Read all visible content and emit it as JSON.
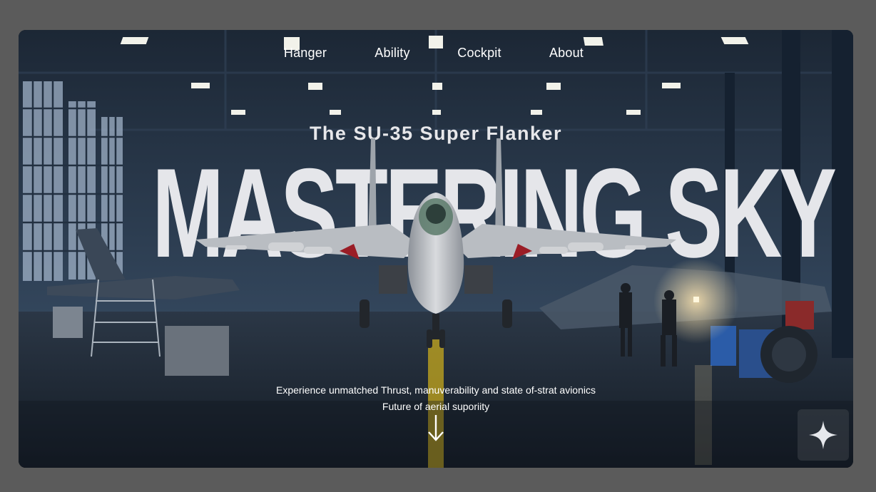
{
  "nav": {
    "items": [
      {
        "label": "Hanger"
      },
      {
        "label": "Ability"
      },
      {
        "label": "Cockpit"
      },
      {
        "label": "About"
      }
    ]
  },
  "hero": {
    "subtitle": "The SU-35 Super Flanker",
    "headline": "MASTERING SKY",
    "tagline_line1": "Experience unmatched Thrust, manuverability and state of-strat avionics",
    "tagline_line2": "Future of aerial suporiity"
  },
  "icons": {
    "scroll": "arrow-down-icon",
    "assistant": "sparkle-icon"
  },
  "colors": {
    "background": "#5b5b5b",
    "text": "#ffffff",
    "headline": "#e5e6ea"
  }
}
